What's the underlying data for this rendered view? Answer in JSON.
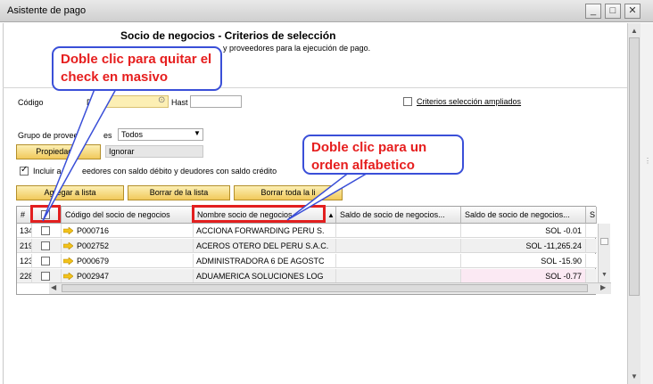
{
  "window": {
    "title": "Asistente de pago",
    "controls": [
      "_",
      "□",
      "✕"
    ]
  },
  "header": {
    "title": "Socio de negocios - Criterios de selección",
    "subtitle": "y proveedores para la ejecución de pago."
  },
  "form": {
    "codigo_label": "Código",
    "desde_label": "Desd",
    "hasta_label": "Hast",
    "criterios_label": "Criterios selección ampliados",
    "grupo_label": "Grupo de provee",
    "grupo_label_tail": "es",
    "grupo_value": "Todos",
    "propiedades_label": "Propiedades",
    "ignorar_label": "Ignorar",
    "incluir_label_a": "Incluir a",
    "incluir_label_b": "eedores con saldo débito y deudores con saldo crédito"
  },
  "buttons": {
    "agregar": "Agregar a lista",
    "borrar": "Borrar de la lista",
    "borrar_toda": "Borrar toda la li"
  },
  "grid": {
    "headers": [
      "#",
      "",
      "Código del socio de negocios",
      "Nombre socio de negocios",
      "Saldo de socio de negocios...",
      "Saldo de socio de negocios...",
      "S"
    ],
    "rows": [
      {
        "num": "134",
        "code": "P000716",
        "name": "ACCIONA FORWARDING PERU S.",
        "saldo1": "",
        "saldo2": "SOL -0.01"
      },
      {
        "num": "219",
        "code": "P002752",
        "name": "ACEROS OTERO DEL PERU S.A.C.",
        "saldo1": "",
        "saldo2": "SOL -11,265.24"
      },
      {
        "num": "123",
        "code": "P000679",
        "name": "ADMINISTRADORA 6 DE AGOSTC",
        "saldo1": "",
        "saldo2": "SOL -15.90"
      },
      {
        "num": "228",
        "code": "P002947",
        "name": "ADUAMERICA SOLUCIONES LOG",
        "saldo1": "",
        "saldo2": "SOL -0.77"
      }
    ]
  },
  "callouts": {
    "left": "Doble clic para quitar el check en masivo",
    "right": "Doble clic para un orden alfabetico"
  },
  "colors": {
    "accent_red": "#e21f1f",
    "callout_border": "#3a4fd8",
    "button_gold": "#f1c95b",
    "arrow_yellow": "#f2c21b"
  }
}
